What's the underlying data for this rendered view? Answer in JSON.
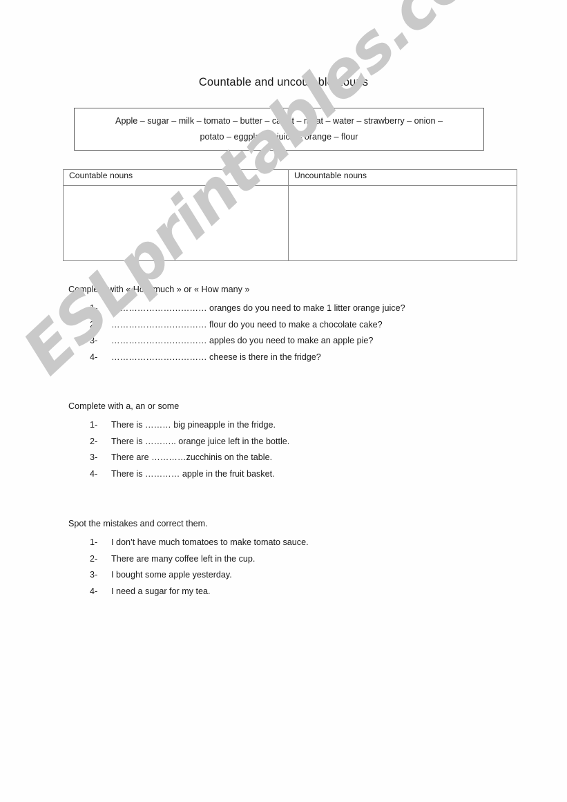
{
  "document": {
    "title": "Countable and uncoutable nouns",
    "watermark": "ESLprintables.com",
    "watermark_color": "#c9c9c9"
  },
  "noun_bank": {
    "line1": "Apple – sugar – milk – tomato – butter – carrot – meat – water – strawberry – onion –",
    "line2": "potato – eggplant – juice – orange – flour"
  },
  "sorting_table": {
    "headers": [
      "Countable nouns",
      "Uncountable nouns"
    ],
    "rows": [
      [
        "",
        ""
      ]
    ]
  },
  "exercises": [
    {
      "heading": "Complete with  «  How much »  or « How many »",
      "items": [
        {
          "number": "1-",
          "text": "…………………………… oranges do you need to make 1 litter orange juice?"
        },
        {
          "number": "2-",
          "text": "…………………………… flour do you need to make a chocolate cake?"
        },
        {
          "number": "3-",
          "text": "…………………………… apples do you need to make an apple pie?"
        },
        {
          "number": "4-",
          "text": "…………………………… cheese is there in the fridge?"
        }
      ]
    },
    {
      "heading": "Complete with a, an or some",
      "items": [
        {
          "number": "1-",
          "text": "There is ……… big pineapple in the fridge."
        },
        {
          "number": "2-",
          "text": "There is ………..  orange juice left in the bottle."
        },
        {
          "number": "3-",
          "text": "There are …………zucchinis on the table."
        },
        {
          "number": "4-",
          "text": "There is ………… apple in the fruit basket."
        }
      ]
    },
    {
      "heading": "Spot the mistakes and correct them.",
      "items": [
        {
          "number": "1-",
          "text": "I don’t have much tomatoes to make tomato sauce."
        },
        {
          "number": "2-",
          "text": "There are many  coffee left in the cup."
        },
        {
          "number": "3-",
          "text": "I bought some apple yesterday."
        },
        {
          "number": "4-",
          "text": "I need a sugar for my tea."
        }
      ]
    }
  ]
}
